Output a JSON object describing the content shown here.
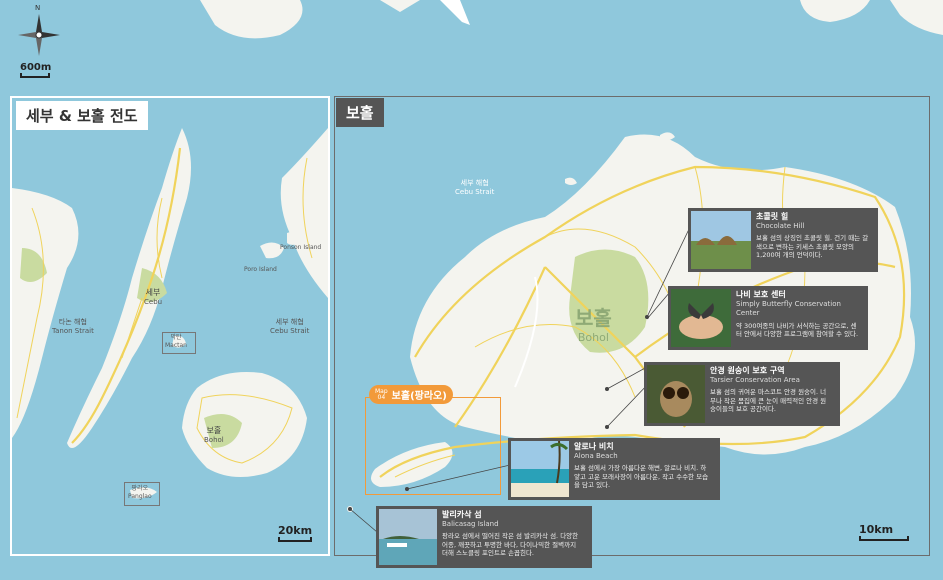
{
  "compass": {
    "north": "N",
    "scale": "600m"
  },
  "left_map": {
    "title": "세부 & 보홀 전도",
    "labels": {
      "tanon_ko": "타논 해협",
      "tanon_en": "Tanon Strait",
      "cebu_ko": "세부",
      "cebu_en": "Cebu",
      "mactan_ko": "막탄",
      "mactan_en": "Mactan",
      "cebu_strait_ko": "세부 해협",
      "cebu_strait_en": "Cebu Strait",
      "bohol_ko": "보홀",
      "bohol_en": "Bohol",
      "panglao_ko": "팡라오",
      "panglao_en": "Panglao",
      "poro_en": "Poro Island",
      "ponson_en": "Ponson Island"
    },
    "scale": "20km"
  },
  "right_map": {
    "title": "보홀",
    "labels": {
      "strait_ko": "세부 해협",
      "strait_en": "Cebu Strait",
      "bohol_ko": "보홀",
      "bohol_en": "Bohol"
    },
    "map_tag": {
      "map": "Map",
      "num": "04",
      "label": "보홀(팡라오)"
    },
    "scale": "10km"
  },
  "callouts": [
    {
      "ko": "초콜릿 힐",
      "en": "Chocolate Hill",
      "desc": "보홀 섬의 상징인 초콜릿 힐. 건기 때는 갈색으로 변하는 키세스 초콜릿 모양의 1,200여 개의 언덕이다."
    },
    {
      "ko": "나비 보호 센터",
      "en": "Simply Butterfly Conservation Center",
      "desc": "약 300여종의 나비가 서식하는 공간으로, 센터 안에서 다양한 프로그램에 참여할 수 있다."
    },
    {
      "ko": "안경 원숭이 보호 구역",
      "en": "Tarsier Conservation Area",
      "desc": "보홀 섬의 귀여운 마스코트 안경 원숭이. 너무나 작은 몸집에 큰 눈이 매력적인 안경 원숭이들의 보호 공간이다."
    },
    {
      "ko": "알로나 비치",
      "en": "Alona Beach",
      "desc": "보홀 섬에서 가장 아름다운 해변, 알로나 비치. 하얗고 고운 모래사장이 아름다운, 작고 수수한 모습을 담고 있다."
    },
    {
      "ko": "발리카삭 섬",
      "en": "Balicasag Island",
      "desc": "팡라오 섬에서 떨어진 작은 섬 발리카삭 섬. 다양한 어종, 깨끗하고 투명한 바다, 다이나믹한 절벽까지 더해 스노클링 포인트로 손꼽힌다."
    }
  ],
  "colors": {
    "sea": "#8fc8dc",
    "land": "#f4f4ef",
    "green": "#c9dba0",
    "road": "#f0d35b",
    "orange": "#f29a3a",
    "callout": "#555555"
  }
}
